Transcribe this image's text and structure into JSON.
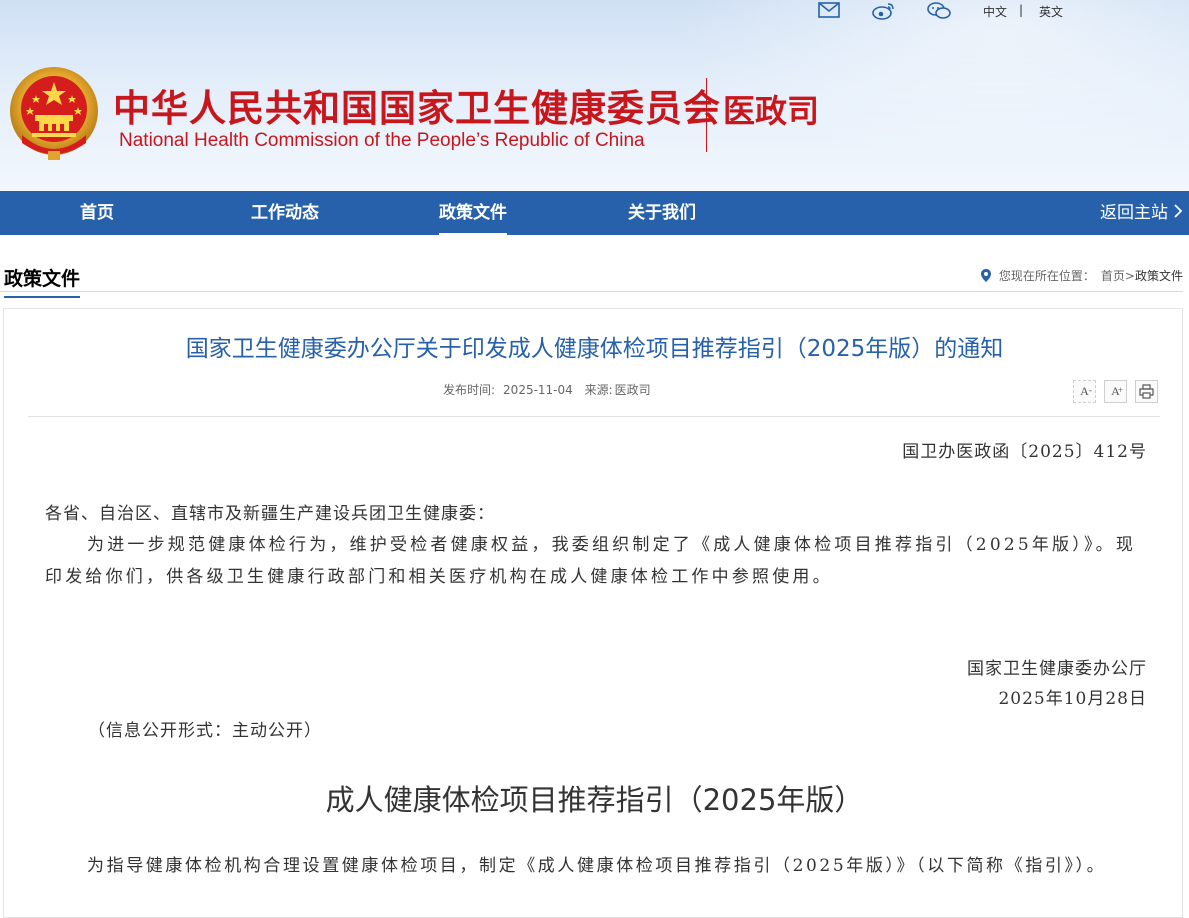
{
  "header": {
    "title_cn": "中华人民共和国国家卫生健康委员会",
    "title_en": "National Health Commission of the People’s  Republic of China",
    "department": "医政司",
    "top_links": {
      "icons": [
        "mail-icon",
        "weibo-icon",
        "wechat-icon"
      ],
      "lang_cn": "中文",
      "separator": "|",
      "lang_en": "英文"
    },
    "colors": {
      "brand_red": "#c8161d",
      "nav_blue": "#2761ab"
    }
  },
  "nav": {
    "items": [
      {
        "label": "首页"
      },
      {
        "label": "工作动态"
      },
      {
        "label": "政策文件",
        "active": true
      },
      {
        "label": "关于我们"
      }
    ],
    "home_link": "返回主站"
  },
  "section": {
    "title": "政策文件",
    "breadcrumb": {
      "prefix": "您现在所在位置：",
      "home": "首页",
      "sep": ">",
      "current": "政策文件"
    }
  },
  "article": {
    "title": "国家卫生健康委办公厅关于印发成人健康体检项目推荐指引（2025年版）的通知",
    "publish_label": "发布时间:",
    "publish_date": "2025-11-04",
    "source_label": "来源:",
    "source": "医政司",
    "tools": {
      "font_smaller": "A",
      "font_larger": "A",
      "print": "print-icon"
    },
    "doc_number": "国卫办医政函〔2025〕412号",
    "greeting": "各省、自治区、直辖市及新疆生产建设兵团卫生健康委：",
    "paragraph1": "为进一步规范健康体检行为，维护受检者健康权益，我委组织制定了《成人健康体检项目推荐指引（2025年版）》。现印发给你们，供各级卫生健康行政部门和相关医疗机构在成人健康体检工作中参照使用。",
    "signature_org": "国家卫生健康委办公厅",
    "signature_date": "2025年10月28日",
    "disclosure": "（信息公开形式：主动公开）",
    "guide_title": "成人健康体检项目推荐指引（2025年版）",
    "paragraph2": "为指导健康体检机构合理设置健康体检项目，制定《成人健康体检项目推荐指引（2025年版）》（以下简称《指引》）。"
  }
}
